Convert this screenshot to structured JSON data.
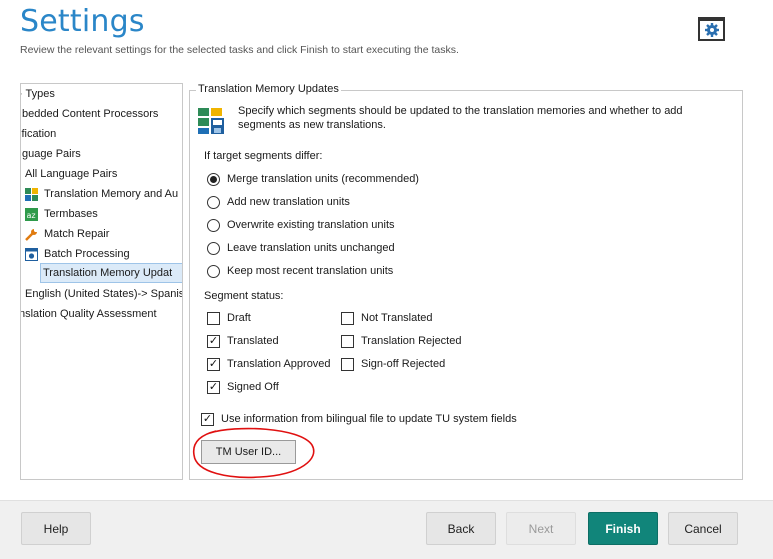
{
  "header": {
    "title": "Settings",
    "subtitle": "Review the relevant settings for the selected tasks and click Finish to start executing the tasks.",
    "settings_icon": "gear-icon"
  },
  "tree": {
    "items": [
      {
        "label": "· Types",
        "icon": null
      },
      {
        "label": "ıbedded Content Processors",
        "icon": null
      },
      {
        "label": "ification",
        "icon": null
      },
      {
        "label": "ıguage Pairs",
        "icon": null
      },
      {
        "label": "All Language Pairs",
        "icon": null
      },
      {
        "label": "Translation Memory and Au",
        "icon": "translation-memory-icon"
      },
      {
        "label": "Termbases",
        "icon": "termbase-icon"
      },
      {
        "label": "Match Repair",
        "icon": "wrench-icon"
      },
      {
        "label": "Batch Processing",
        "icon": "batch-gear-icon"
      },
      {
        "label": "Translation Memory Updat",
        "icon": null
      },
      {
        "label": "English (United States)-> Spanis",
        "icon": null
      },
      {
        "label": "nslation Quality Assessment",
        "icon": null
      }
    ]
  },
  "group": {
    "legend": "Translation Memory Updates",
    "description": "Specify which segments should be updated to the translation memories and whether to add segments as new translations.",
    "differ_label": "If target segments differ:",
    "radios": [
      {
        "label": "Merge translation units (recommended)",
        "checked": true
      },
      {
        "label": "Add new translation units",
        "checked": false
      },
      {
        "label": "Overwrite existing translation units",
        "checked": false
      },
      {
        "label": "Leave translation units unchanged",
        "checked": false
      },
      {
        "label": "Keep most recent translation units",
        "checked": false
      }
    ],
    "status_label": "Segment status:",
    "status_left": [
      {
        "label": "Draft",
        "checked": false
      },
      {
        "label": "Translated",
        "checked": true
      },
      {
        "label": "Translation Approved",
        "checked": true
      },
      {
        "label": "Signed Off",
        "checked": true
      }
    ],
    "status_right": [
      {
        "label": "Not Translated",
        "checked": false
      },
      {
        "label": "Translation Rejected",
        "checked": false
      },
      {
        "label": "Sign-off Rejected",
        "checked": false
      }
    ],
    "bilingual": {
      "label": "Use information from bilingual file to update TU system fields",
      "checked": true
    },
    "tm_user_button": "TM User ID..."
  },
  "footer": {
    "help": "Help",
    "back": "Back",
    "next": "Next",
    "finish": "Finish",
    "cancel": "Cancel"
  },
  "colors": {
    "title": "#2a86c8",
    "primary_button": "#11857a",
    "annotation": "#e01010"
  }
}
